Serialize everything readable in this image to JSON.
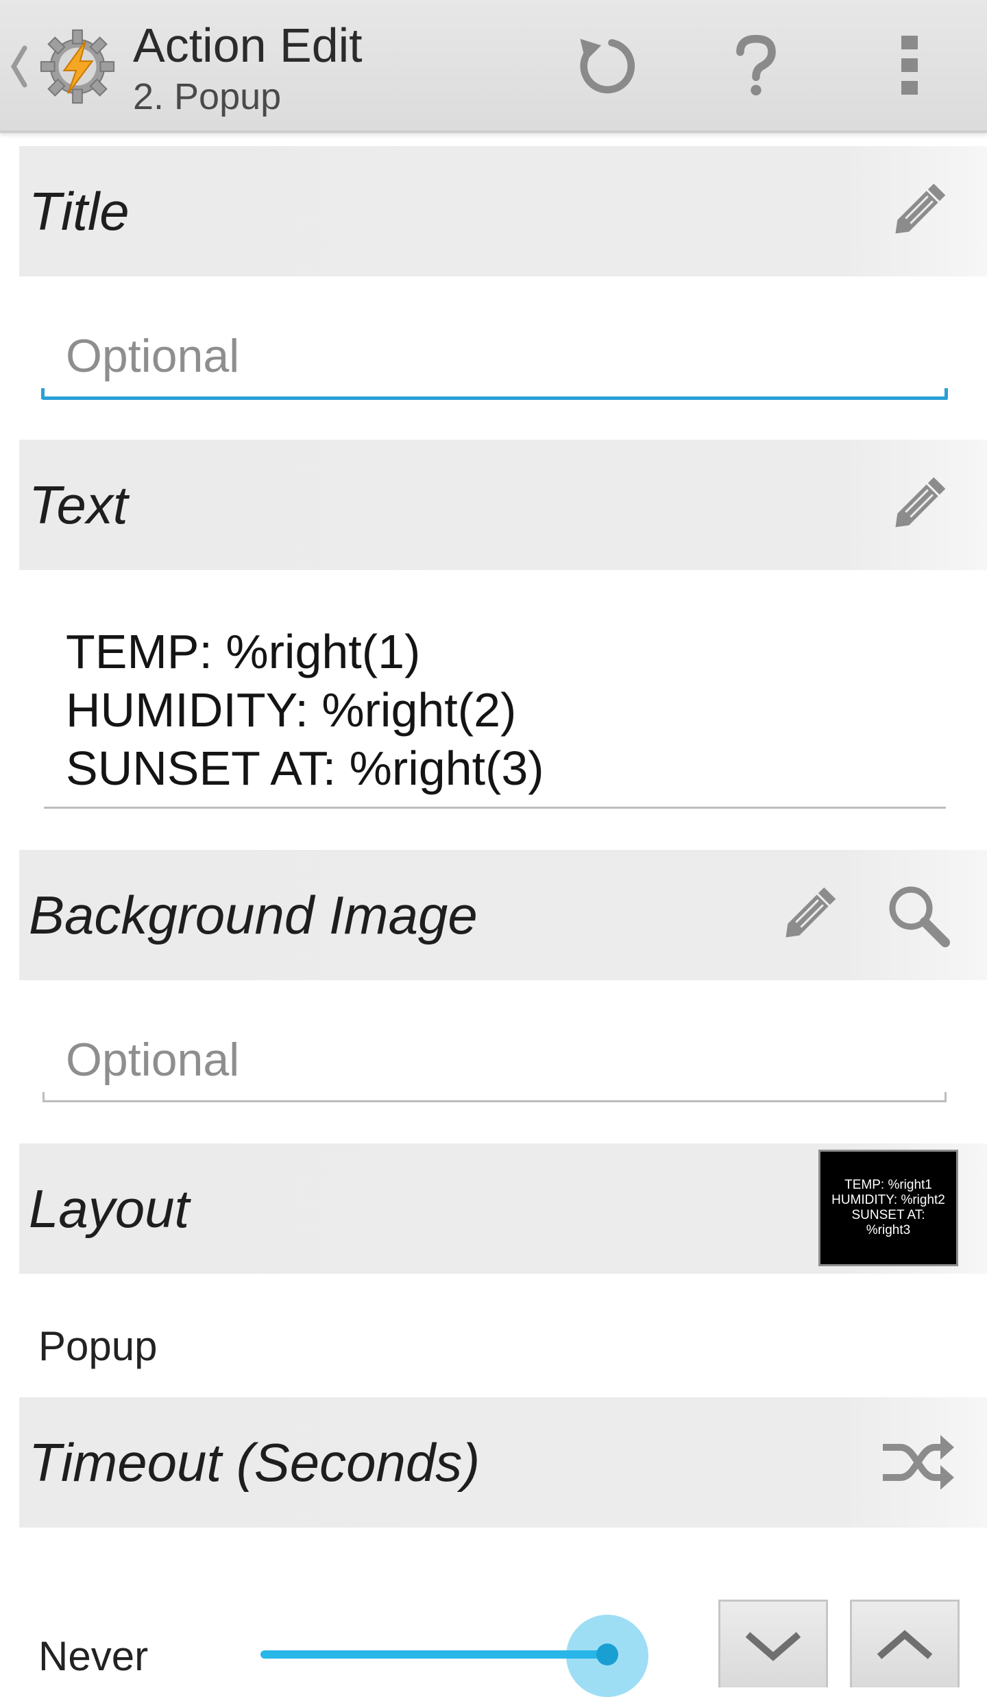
{
  "app_bar": {
    "title": "Action Edit",
    "subtitle": "2. Popup",
    "icons": [
      "chevron-left-icon",
      "tasker-app-icon",
      "undo-icon",
      "help-icon",
      "overflow-menu-icon"
    ]
  },
  "sections": {
    "title": {
      "label": "Title",
      "input_placeholder": "Optional",
      "input_value": ""
    },
    "text": {
      "label": "Text",
      "lines": [
        "TEMP: %right(1)",
        "HUMIDITY: %right(2)",
        "SUNSET AT: %right(3)"
      ]
    },
    "background_image": {
      "label": "Background Image",
      "input_placeholder": "Optional",
      "input_value": ""
    },
    "layout": {
      "label": "Layout",
      "value": "Popup",
      "preview_lines": [
        "TEMP: %right1",
        "HUMIDITY: %right2",
        "SUNSET AT:",
        "%right3"
      ]
    },
    "timeout": {
      "label": "Timeout (Seconds)",
      "value": "Never",
      "slider_fraction": 1.0
    }
  },
  "colors": {
    "accent": "#29b6e8",
    "focus_underline": "#2aa0d6",
    "section_bg": "#ebebeb",
    "app_bar_bg": "#e0e0e0"
  }
}
